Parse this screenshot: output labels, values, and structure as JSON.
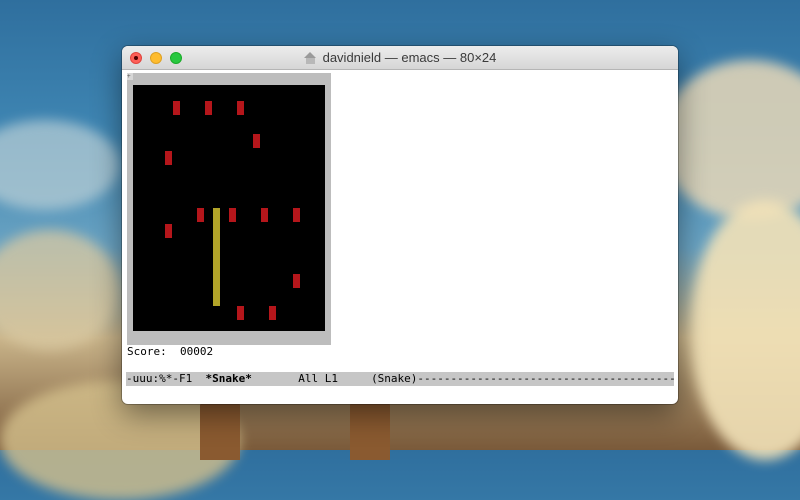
{
  "window": {
    "title": "davidnield — emacs — 80×24"
  },
  "game": {
    "name": "Snake",
    "board_cols": 24,
    "board_rows": 30,
    "fruits": [
      {
        "col": 5,
        "row": 2
      },
      {
        "col": 9,
        "row": 2
      },
      {
        "col": 13,
        "row": 2
      },
      {
        "col": 15,
        "row": 6
      },
      {
        "col": 4,
        "row": 8
      },
      {
        "col": 8,
        "row": 15
      },
      {
        "col": 12,
        "row": 15
      },
      {
        "col": 16,
        "row": 15
      },
      {
        "col": 20,
        "row": 15
      },
      {
        "col": 4,
        "row": 17
      },
      {
        "col": 20,
        "row": 23
      },
      {
        "col": 13,
        "row": 27
      },
      {
        "col": 17,
        "row": 27
      }
    ],
    "snake": {
      "col": 10,
      "row_start": 15,
      "row_end": 26
    }
  },
  "score": {
    "label": "Score:",
    "value": "00002"
  },
  "modeline": {
    "prefix": "-uuu:%*-F1  ",
    "buffer": "*Snake*",
    "position": "       All L1     ",
    "mode": "(Snake)-----------------------------------------------"
  },
  "colors": {
    "fruit": "#b5161b",
    "snake": "#b2a429",
    "board": "#000000"
  }
}
